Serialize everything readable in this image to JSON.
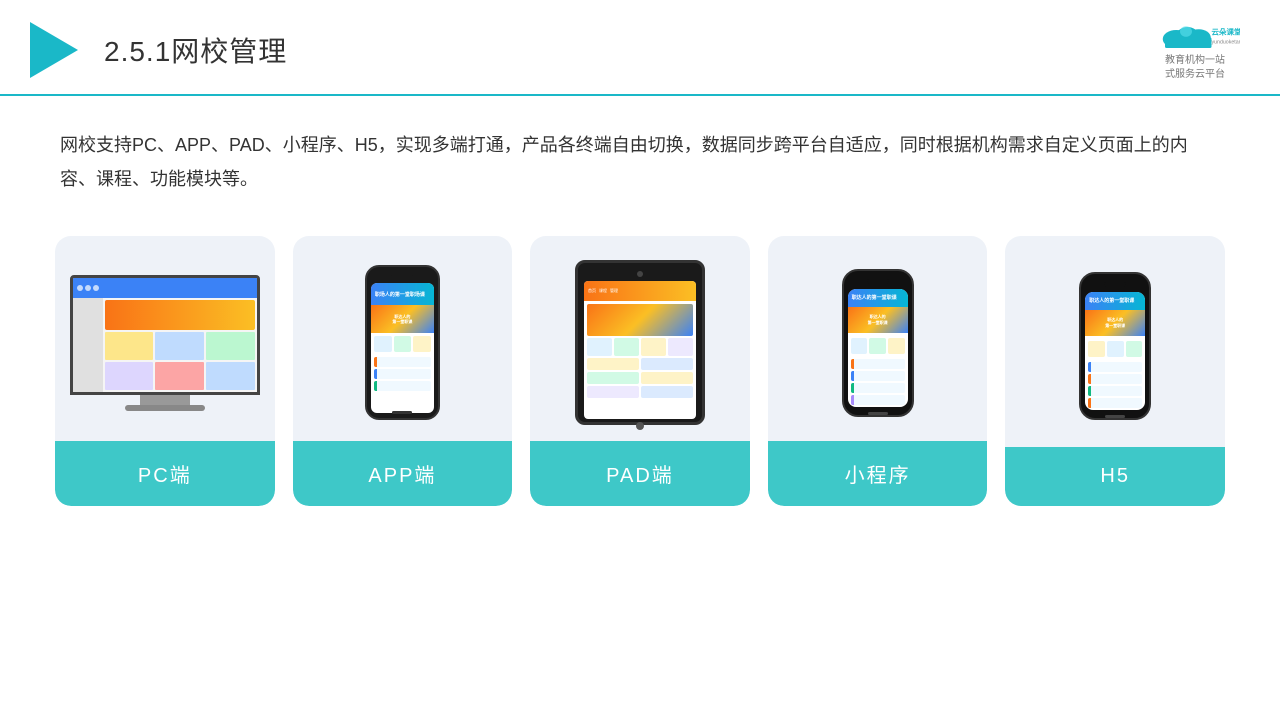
{
  "header": {
    "title_number": "2.5.1",
    "title_text": "网校管理",
    "logo_brand": "云朵课堂",
    "logo_url": "yunduoketang.com",
    "logo_tagline": "教育机构一站\n式服务云平台"
  },
  "description": {
    "text": "网校支持PC、APP、PAD、小程序、H5，实现多端打通，产品各终端自由切换，数据同步跨平台自适应，同时根据机构需求自定义页面上的内容、课程、功能模块等。"
  },
  "cards": [
    {
      "id": "pc",
      "label": "PC端"
    },
    {
      "id": "app",
      "label": "APP端"
    },
    {
      "id": "pad",
      "label": "PAD端"
    },
    {
      "id": "miniprogram",
      "label": "小程序"
    },
    {
      "id": "h5",
      "label": "H5"
    }
  ],
  "colors": {
    "teal": "#3ec8c8",
    "accent_blue": "#1ab8c8",
    "card_bg": "#eef2f8"
  }
}
